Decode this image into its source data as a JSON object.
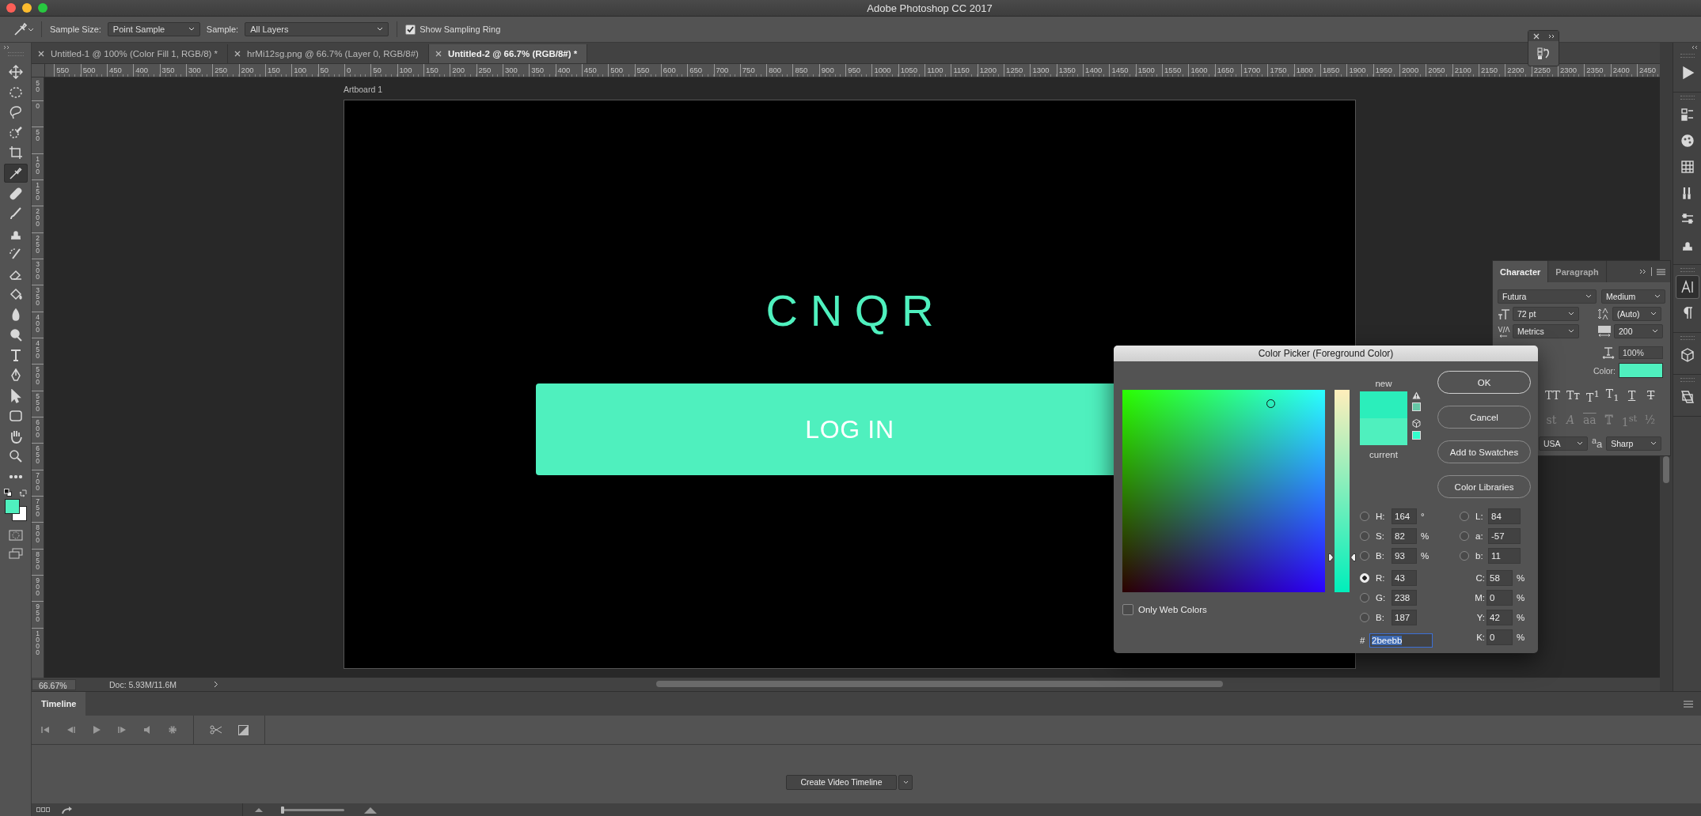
{
  "window": {
    "title": "Adobe Photoshop CC 2017"
  },
  "options_bar": {
    "sample_size_label": "Sample Size:",
    "sample_size": "Point Sample",
    "sample_label": "Sample:",
    "sample": "All Layers",
    "sampling_ring": {
      "label": "Show Sampling Ring",
      "checked": true
    }
  },
  "tabs": [
    {
      "label": "Untitled-1 @ 100% (Color Fill 1, RGB/8) *",
      "selected": false
    },
    {
      "label": "hrMi12sg.png @ 66.7% (Layer 0, RGB/8#)",
      "selected": false
    },
    {
      "label": "Untitled-2 @ 66.7% (RGB/8#) *",
      "selected": true
    }
  ],
  "ruler": {
    "horizontal": [
      "550",
      "500",
      "450",
      "400",
      "350",
      "300",
      "250",
      "200",
      "150",
      "100",
      "50",
      "0",
      "50",
      "100",
      "150",
      "200",
      "250",
      "300",
      "350",
      "400",
      "450",
      "500",
      "550",
      "600",
      "650",
      "700",
      "750",
      "800",
      "850",
      "900",
      "950",
      "1000",
      "1050",
      "1100",
      "1150",
      "1200",
      "1250",
      "1300",
      "1350",
      "1400",
      "1450",
      "1500",
      "1550",
      "1600",
      "1650",
      "1700",
      "1750",
      "1800",
      "1850",
      "1900",
      "1950",
      "2000",
      "2050",
      "2100",
      "2150",
      "2200",
      "2250",
      "2300",
      "2350",
      "2400",
      "2450"
    ],
    "vertical": [
      "50",
      "0",
      "50",
      "100",
      "150",
      "200",
      "250",
      "300",
      "350",
      "400",
      "450",
      "500",
      "550",
      "600",
      "650",
      "700",
      "750",
      "800",
      "850",
      "900",
      "950",
      "1000"
    ]
  },
  "tools": [
    {
      "kind": "move",
      "selected": false
    },
    {
      "kind": "marquee",
      "selected": false
    },
    {
      "kind": "lasso",
      "selected": false
    },
    {
      "kind": "quick-select",
      "selected": false
    },
    {
      "kind": "crop",
      "selected": false
    },
    {
      "kind": "eyedropper",
      "selected": true
    },
    {
      "kind": "bandage",
      "selected": false
    },
    {
      "kind": "brush",
      "selected": false
    },
    {
      "kind": "stamp",
      "selected": false
    },
    {
      "kind": "history-brush",
      "selected": false
    },
    {
      "kind": "eraser",
      "selected": false
    },
    {
      "kind": "bucket",
      "selected": false
    },
    {
      "kind": "drop",
      "selected": false
    },
    {
      "kind": "dodge",
      "selected": false
    },
    {
      "kind": "type",
      "selected": false
    },
    {
      "kind": "pen",
      "selected": false
    },
    {
      "kind": "pointer",
      "selected": false
    },
    {
      "kind": "shape",
      "selected": false
    },
    {
      "kind": "hand",
      "selected": false
    },
    {
      "kind": "zoom",
      "selected": false
    },
    {
      "kind": "more",
      "selected": false
    }
  ],
  "artboard": {
    "name": "Artboard 1",
    "logo": "CNQR",
    "button": "LOG IN"
  },
  "status_bar": {
    "zoom": "66.67%",
    "doc": "Doc: 5.93M/11.6M"
  },
  "panel_icon_groups": [
    [
      {
        "kind": "play",
        "selected": false
      }
    ],
    [
      {
        "kind": "properties",
        "selected": false
      },
      {
        "kind": "palette",
        "selected": false
      },
      {
        "kind": "grid",
        "selected": false
      },
      {
        "kind": "brushes",
        "selected": false
      },
      {
        "kind": "sliders",
        "selected": false
      },
      {
        "kind": "stamp",
        "selected": false
      }
    ],
    [
      {
        "kind": "character",
        "selected": true
      },
      {
        "kind": "paragraph",
        "selected": false
      }
    ],
    [
      {
        "kind": "cube",
        "selected": false
      }
    ],
    [
      {
        "kind": "comps",
        "selected": false
      }
    ]
  ],
  "character_panel": {
    "tabs": [
      {
        "label": "Character",
        "selected": true
      },
      {
        "label": "Paragraph",
        "selected": false
      }
    ],
    "font": "Futura",
    "style": "Medium",
    "size": "72 pt",
    "leading": "(Auto)",
    "kerning": "Metrics",
    "tracking": "200",
    "scale": "100%",
    "color_label": "Color:",
    "color": "#4ff0be",
    "styles": [
      {
        "text": "TT",
        "kind": "plain"
      },
      {
        "text": "Tᴛ",
        "kind": "plain"
      },
      {
        "text": "T$^{1}$",
        "kind": "plain"
      },
      {
        "text": "T$_{1}$",
        "kind": "plain"
      },
      {
        "text": "T",
        "kind": "underline"
      },
      {
        "text": "T",
        "kind": "strike"
      }
    ],
    "opentype": [
      {
        "text": "st",
        "kind": "plain"
      },
      {
        "text": "A",
        "kind": "italic"
      },
      {
        "text": "aa",
        "kind": "overline"
      },
      {
        "text": "T",
        "kind": "outline"
      },
      {
        "text": "1$^{st}$",
        "kind": "plain"
      },
      {
        "text": "½",
        "kind": "plain"
      }
    ],
    "language": "USA",
    "antialias_label": "$^{a}$a",
    "antialias": "Sharp"
  },
  "picker": {
    "title": "Color Picker (Foreground Color)",
    "buttons": [
      "OK",
      "Cancel",
      "Add to Swatches",
      "Color Libraries"
    ],
    "new_label": "new",
    "current_label": "current",
    "slider": {
      "level": 0.17
    },
    "alt_colors": [
      {
        "color": "#66c7a6"
      },
      {
        "color": "#33ffcc"
      }
    ],
    "web_only": {
      "label": "Only Web Colors",
      "checked": false
    },
    "hsb": [
      {
        "label": "H:",
        "value": "164",
        "unit": "°",
        "selected": false
      },
      {
        "label": "S:",
        "value": "82",
        "unit": "%",
        "selected": false
      },
      {
        "label": "B:",
        "value": "93",
        "unit": "%",
        "selected": false
      }
    ],
    "rgb": [
      {
        "label": "R:",
        "value": "43",
        "selected": true
      },
      {
        "label": "G:",
        "value": "238",
        "selected": false
      },
      {
        "label": "B:",
        "value": "187",
        "selected": false
      }
    ],
    "hex": {
      "label": "#",
      "value": "2beebb",
      "text_selected": true
    },
    "lab": [
      {
        "label": "L:",
        "value": "84",
        "selected": false
      },
      {
        "label": "a:",
        "value": "-57",
        "selected": false
      },
      {
        "label": "b:",
        "value": "11",
        "selected": false
      }
    ],
    "cmyk": [
      {
        "label": "C:",
        "value": "58",
        "unit": "%"
      },
      {
        "label": "M:",
        "value": "0",
        "unit": "%"
      },
      {
        "label": "Y:",
        "value": "42",
        "unit": "%"
      },
      {
        "label": "K:",
        "value": "0",
        "unit": "%"
      }
    ]
  },
  "timeline": {
    "tab": "Timeline",
    "create_button": "Create Video Timeline",
    "zoom": {
      "level": 0.0
    }
  }
}
